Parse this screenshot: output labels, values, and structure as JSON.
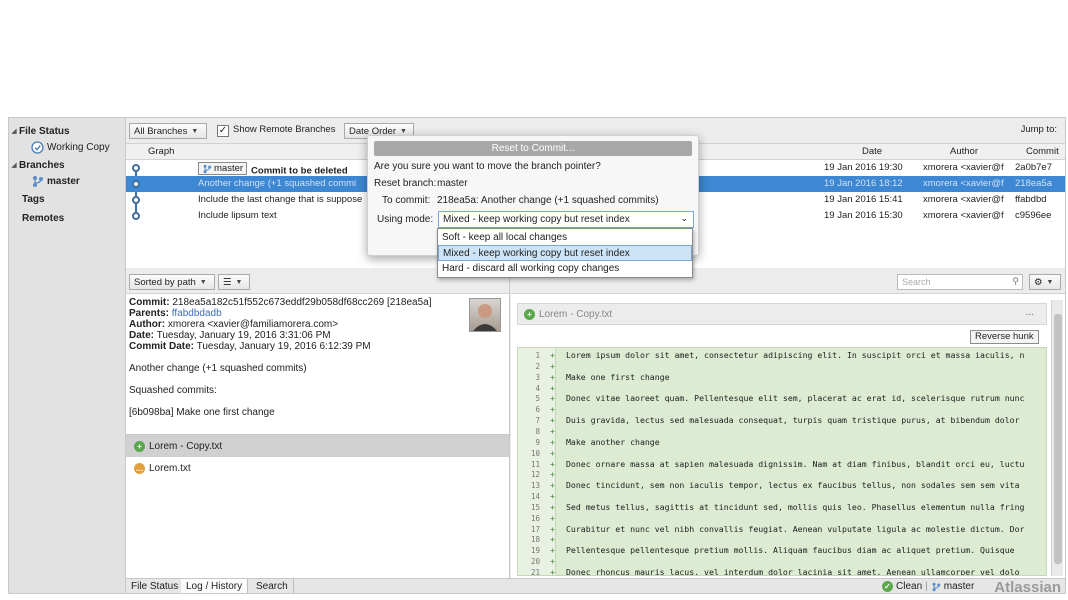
{
  "sidebar": {
    "file_status": "File Status",
    "working_copy": "Working Copy",
    "branches": "Branches",
    "master": "master",
    "tags": "Tags",
    "remotes": "Remotes"
  },
  "toolbar": {
    "branches_select": "All Branches",
    "show_remote_checked": true,
    "show_remote": "Show Remote Branches",
    "order_select": "Date Order",
    "jump_to": "Jump to:"
  },
  "table": {
    "headers": {
      "graph": "Graph",
      "date": "Date",
      "author": "Author",
      "commit": "Commit"
    },
    "rows": [
      {
        "branch_tag": "master",
        "description": "Commit to be deleted",
        "date": "19 Jan 2016 19:30",
        "author": "xmorera <xavier@f",
        "commit": "2a0b7e7",
        "selected": false
      },
      {
        "branch_tag": "",
        "description": "Another change (+1 squashed commi",
        "date": "19 Jan 2016 18:12",
        "author": "xmorera <xavier@f",
        "commit": "218ea5a",
        "selected": true
      },
      {
        "branch_tag": "",
        "description": "Include the last change that is suppose",
        "date": "19 Jan 2016 15:41",
        "author": "xmorera <xavier@f",
        "commit": "ffabdbd",
        "selected": false
      },
      {
        "branch_tag": "",
        "description": "Include lipsum text",
        "date": "19 Jan 2016 15:30",
        "author": "xmorera <xavier@f",
        "commit": "c9596ee",
        "selected": false
      }
    ]
  },
  "left_panel": {
    "sort_select": "Sorted by path",
    "commit_label": "Commit:",
    "commit_value": "218ea5a182c51f552c673eddf29b058df68cc269 [218ea5a]",
    "parents_label": "Parents:",
    "parents_value": "ffabdbdadb",
    "author_label": "Author:",
    "author_value": "xmorera <xavier@familiamorera.com>",
    "date_label": "Date:",
    "date_value": "Tuesday, January 19, 2016 3:31:06 PM",
    "commit_date_label": "Commit Date:",
    "commit_date_value": "Tuesday, January 19, 2016 6:12:39 PM",
    "message_1": "Another change (+1 squashed commits)",
    "message_2": "Squashed commits:",
    "message_3": "[6b098ba] Make one first change",
    "files": [
      {
        "name": "Lorem - Copy.txt",
        "status": "added",
        "selected": true
      },
      {
        "name": "Lorem.txt",
        "status": "modified",
        "selected": false
      }
    ]
  },
  "diff_panel": {
    "search_placeholder": "Search",
    "file_name": "Lorem - Copy.txt",
    "menu": "...",
    "reverse_hunk": "Reverse hunk",
    "lines": [
      {
        "n": "1",
        "t": "Lorem ipsum dolor sit amet, consectetur adipiscing elit. In suscipit orci et massa iaculis, n"
      },
      {
        "n": "2",
        "t": ""
      },
      {
        "n": "3",
        "t": "Make one first change"
      },
      {
        "n": "4",
        "t": ""
      },
      {
        "n": "5",
        "t": "Donec vitae laoreet quam. Pellentesque elit sem, placerat ac erat id, scelerisque rutrum nunc"
      },
      {
        "n": "6",
        "t": ""
      },
      {
        "n": "7",
        "t": "Duis gravida, lectus sed malesuada consequat, turpis quam tristique purus, at bibendum dolor"
      },
      {
        "n": "8",
        "t": ""
      },
      {
        "n": "9",
        "t": "Make another change"
      },
      {
        "n": "10",
        "t": ""
      },
      {
        "n": "11",
        "t": "Donec ornare massa at sapien malesuada dignissim. Nam at diam finibus, blandit orci eu, luctu"
      },
      {
        "n": "12",
        "t": ""
      },
      {
        "n": "13",
        "t": "Donec tincidunt, sem non iaculis tempor, lectus ex faucibus tellus, non sodales sem sem vita"
      },
      {
        "n": "14",
        "t": ""
      },
      {
        "n": "15",
        "t": "Sed metus tellus, sagittis at tincidunt sed, mollis quis leo. Phasellus elementum nulla fring"
      },
      {
        "n": "16",
        "t": ""
      },
      {
        "n": "17",
        "t": "Curabitur et nunc vel nibh convallis feugiat. Aenean vulputate ligula ac molestie dictum. Dor"
      },
      {
        "n": "18",
        "t": ""
      },
      {
        "n": "19",
        "t": "Pellentesque pellentesque pretium mollis. Aliquam faucibus diam ac aliquet pretium. Quisque"
      },
      {
        "n": "20",
        "t": ""
      },
      {
        "n": "21",
        "t": "Donec rhoncus mauris lacus, vel interdum dolor lacinia sit amet. Aenean ullamcorper vel dolo"
      }
    ]
  },
  "bottom_bar": {
    "tab_file_status": "File Status",
    "tab_log": "Log / History",
    "tab_search": "Search",
    "clean": "Clean",
    "branch": "master",
    "brand": "Atlassian"
  },
  "dialog": {
    "title": "Reset to Commit...",
    "question": "Are you sure you want to move the branch pointer?",
    "reset_branch_label": "Reset branch:",
    "reset_branch_value": "master",
    "to_commit_label": "To commit:",
    "to_commit_value": "218ea5a: Another change (+1 squashed commits)",
    "mode_label": "Using mode:",
    "mode_selected": "Mixed - keep working copy but reset index",
    "options": [
      {
        "label": "Soft - keep all local changes",
        "selected": false
      },
      {
        "label": "Mixed - keep working copy but reset index",
        "selected": true
      },
      {
        "label": "Hard - discard all working copy changes",
        "selected": false
      }
    ]
  }
}
